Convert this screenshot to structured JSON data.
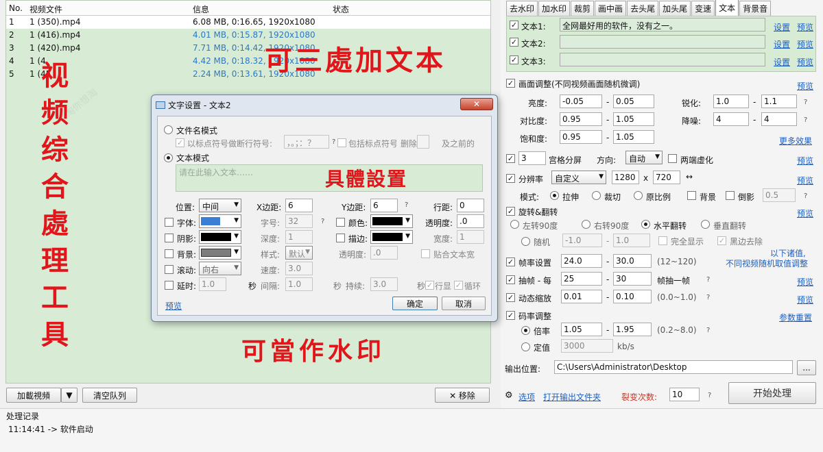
{
  "list": {
    "headers": {
      "no": "No.",
      "file": "视频文件",
      "info": "信息",
      "status": "状态"
    },
    "rows": [
      {
        "no": "1",
        "file": "1 (350).mp4",
        "info": "6.08 MB, 0:16.65, 1920x1080"
      },
      {
        "no": "2",
        "file": "1 (416).mp4",
        "info": "4.01 MB, 0:15.87, 1920x1080"
      },
      {
        "no": "3",
        "file": "1 (420).mp4",
        "info": "7.71 MB, 0:14.42, 1920x1080"
      },
      {
        "no": "4",
        "file": "1 (4",
        "info": "4.42 MB, 0:18.32, 1920x1080"
      },
      {
        "no": "5",
        "file": "1 (45",
        "info": "2.24 MB, 0:13.61, 1920x1080"
      }
    ]
  },
  "overlay": {
    "left_vertical": [
      "视",
      "频",
      "综",
      "合",
      "處",
      "理",
      "工",
      "具"
    ],
    "top_text": "可三處加文本",
    "mid_text": "具體設置",
    "bottom_text": "可當作水印"
  },
  "bottom_left": {
    "load_label": "加載視頻",
    "clear_label": "清空队列",
    "remove_label": "✕ 移除"
  },
  "log": {
    "title": "处理记录",
    "entry": "11:14:41 -> 软件启动"
  },
  "tabs": [
    "去水印",
    "加水印",
    "裁剪",
    "画中画",
    "去头尾",
    "加头尾",
    "变速",
    "文本",
    "背景音"
  ],
  "text_rows": [
    {
      "label": "文本1:",
      "value": "全网最好用的软件，没有之一。",
      "setting": "设置",
      "preview": "预览"
    },
    {
      "label": "文本2:",
      "value": "",
      "setting": "设置",
      "preview": "预览"
    },
    {
      "label": "文本3:",
      "value": "",
      "setting": "设置",
      "preview": "预览"
    }
  ],
  "adjust": {
    "title": "画面调整(不同视频画面随机微调)",
    "preview": "预览",
    "brightness": {
      "label": "亮度:",
      "a": "-0.05",
      "b": "0.05"
    },
    "sharpen": {
      "label": "锐化:",
      "a": "1.0",
      "b": "1.1"
    },
    "contrast": {
      "label": "对比度:",
      "a": "0.95",
      "b": "1.05"
    },
    "denoise": {
      "label": "降噪:",
      "a": "4",
      "b": "4"
    },
    "saturation": {
      "label": "饱和度:",
      "a": "0.95",
      "b": "1.05"
    },
    "more": "更多效果"
  },
  "grid": {
    "count": "3",
    "label": "宫格分屏",
    "dir_label": "方向:",
    "dir": "自动",
    "blur": "两端虚化",
    "preview": "预览"
  },
  "resolution": {
    "label": "分辨率",
    "preset": "自定义",
    "w": "1280",
    "x": "x",
    "h": "720",
    "swap": "↔",
    "preview": "预览",
    "mode_label": "模式:",
    "stretch": "拉伸",
    "crop": "裁切",
    "ratio": "原比例",
    "bg": "背景",
    "shadow": "倒影",
    "shadow_val": "0.5"
  },
  "rotate": {
    "label": "旋转&翻转",
    "preview": "预览",
    "l90": "左转90度",
    "r90": "右转90度",
    "hflip": "水平翻转",
    "vflip": "垂直翻转",
    "random": "随机",
    "ra": "-1.0",
    "rb": "1.0",
    "full": "完全显示",
    "black": "黑边去除"
  },
  "note": {
    "line1": "以下诸值,",
    "line2": "不同视频随机取值调整"
  },
  "fps": {
    "label": "帧率设置",
    "a": "24.0",
    "b": "30.0",
    "range": "(12~120)"
  },
  "drop": {
    "label": "抽帧 - 每",
    "a": "25",
    "b": "30",
    "unit": "帧抽一帧",
    "preview": "预览"
  },
  "zoom": {
    "label": "动态缩放",
    "a": "0.01",
    "b": "0.10",
    "range": "(0.0~1.0)",
    "preview": "预览"
  },
  "bitrate": {
    "label": "码率调整",
    "reset": "参数重置",
    "mul": "倍率",
    "a": "1.05",
    "b": "1.95",
    "range": "(0.2~8.0)",
    "fixed": "定值",
    "fixed_val": "3000",
    "unit": "kb/s"
  },
  "output": {
    "label": "输出位置:",
    "path": "C:\\Users\\Administrator\\Desktop",
    "browse": "..."
  },
  "footer": {
    "options": "选项",
    "open": "打开输出文件夹",
    "count_label": "裂变次数:",
    "count": "10",
    "start": "开始处理"
  },
  "dialog": {
    "title": "文字设置 - 文本2",
    "close": "✕",
    "filename_mode": "文件名模式",
    "split_label": "以标点符号做断行符号:",
    "split_val": "，。；：？",
    "incl": "包括标点符号",
    "delete": "删除",
    "before": "及之前的",
    "text_mode": "文本模式",
    "placeholder": "请在此输入文本……",
    "pos_label": "位置:",
    "pos": "中间",
    "xm_label": "X边距:",
    "xm": "6",
    "ym_label": "Y边距:",
    "ym": "6",
    "ls_label": "行距:",
    "ls": "0",
    "font": "字体:",
    "size_label": "字号:",
    "size": "32",
    "color": "颜色:",
    "opacity_label": "透明度:",
    "opacity": ".0",
    "shadow": "阴影:",
    "depth_label": "深度:",
    "depth": "1",
    "stroke": "描边:",
    "width_label": "宽度:",
    "width": "1",
    "bg": "背景:",
    "style_label": "样式:",
    "style": "默认",
    "bg_opacity_label": "透明度:",
    "bg_opacity": ".0",
    "fit": "贴合文本宽",
    "scroll": "滚动:",
    "scroll_dir": "向右",
    "speed_label": "速度:",
    "speed": "3.0",
    "delay": "延时:",
    "delay_val": "1.0",
    "sec": "秒",
    "interval_label": "间隔:",
    "interval": "1.0",
    "sec2": "秒",
    "dur_label": "持续:",
    "dur": "3.0",
    "sec3": "秒",
    "linedisp": "行显",
    "loop": "循环",
    "preview": "预览",
    "ok": "确定",
    "cancel": "取消"
  },
  "colors": {
    "accent_red": "#e0161b",
    "list_bg": "#d7ebd5",
    "link": "#1f5fbf"
  }
}
